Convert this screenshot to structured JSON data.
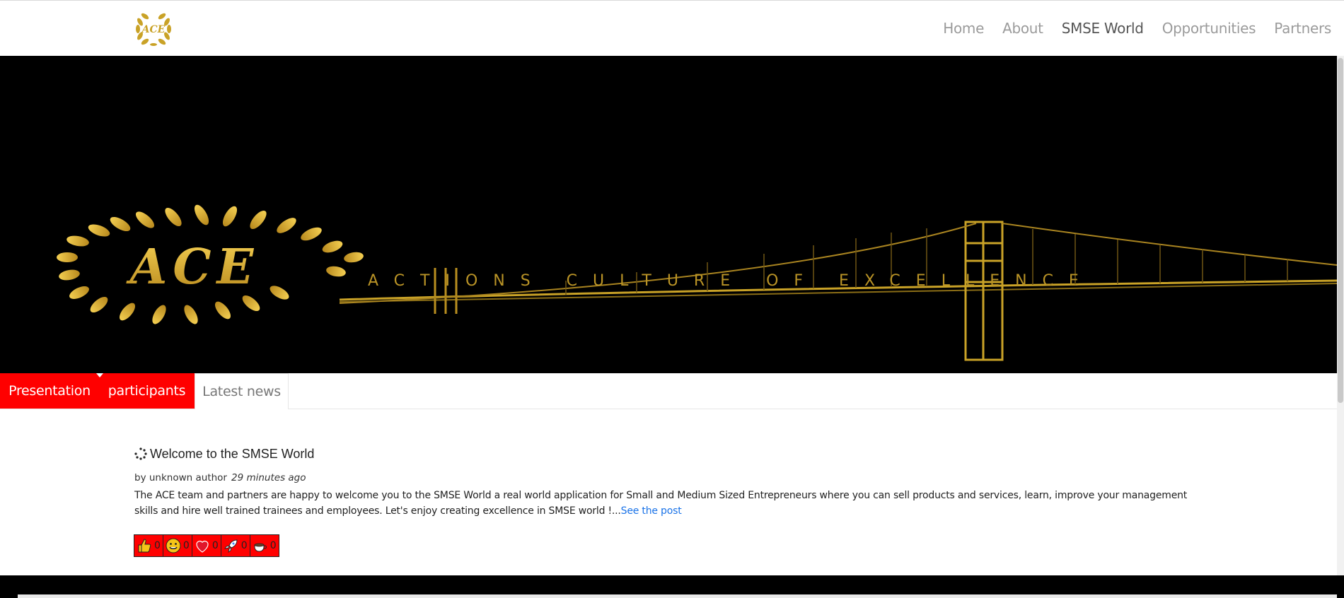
{
  "nav": {
    "items": [
      {
        "label": "Home"
      },
      {
        "label": "About"
      },
      {
        "label": "SMSE World",
        "active": true
      },
      {
        "label": "Opportunities"
      },
      {
        "label": "Partners"
      }
    ]
  },
  "logo": {
    "text": "ACE",
    "color": "#c9a227"
  },
  "hero": {
    "brand": "ACE",
    "tagline": "ACTIONS CULTURE OF EXCELLENCE",
    "background": "#000000",
    "gold": "#e3b531"
  },
  "tabs": [
    {
      "label": "Presentation",
      "active": true
    },
    {
      "label": "participants"
    },
    {
      "label": "Latest news"
    }
  ],
  "post": {
    "title": "Welcome to the SMSE World",
    "author": "by unknown author",
    "time": "29 minutes ago",
    "body": "The ACE team and partners are happy to welcome you to the SMSE World a real world application for Small and Medium Sized Entrepreneurs where you can sell products and services, learn, improve your management skills and hire well trained trainees and employees. Let's enjoy creating excellence in SMSE world !...",
    "link": "See the post"
  },
  "reactions": [
    {
      "icon": "thumbs-up-icon",
      "count": "0"
    },
    {
      "icon": "smiley-icon",
      "count": "0"
    },
    {
      "icon": "heart-icon",
      "count": "0"
    },
    {
      "icon": "rocket-icon",
      "count": "0"
    },
    {
      "icon": "coffee-icon",
      "count": "0"
    }
  ],
  "colors": {
    "accent": "#ff0000",
    "link": "#1a73e8",
    "nav_text": "#9b9b9b"
  }
}
